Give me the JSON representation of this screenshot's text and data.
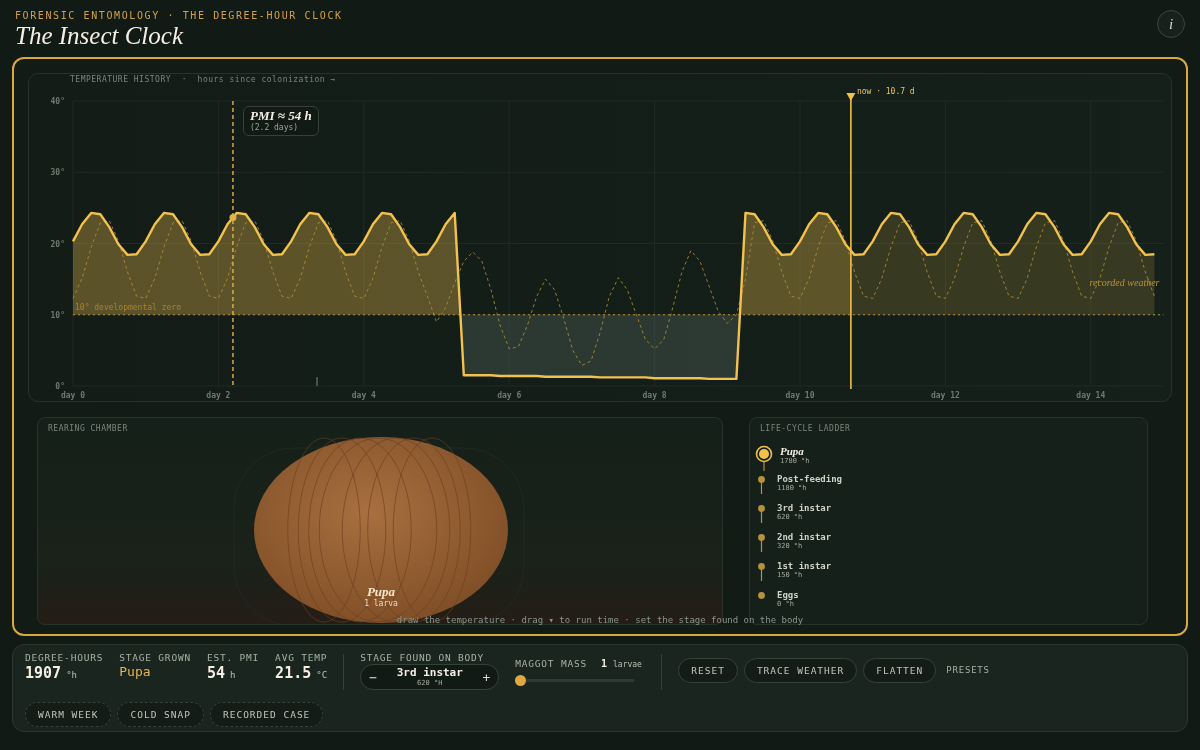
{
  "header": {
    "eyebrow": "FORENSIC ENTOMOLOGY · THE DEGREE-HOUR CLOCK",
    "title": "The Insect Clock",
    "info_button": "i"
  },
  "temperature_history": {
    "title": "TEMPERATURE HISTORY  ·  hours since colonization →",
    "pmi_marker": {
      "label": "PMI ≈ 54 h",
      "sublabel": "(2.2 days)"
    },
    "now_marker": {
      "label": "now · 10.7 d"
    },
    "chart_data": {
      "type": "line",
      "grid": true,
      "ylim": [
        0,
        40
      ],
      "categories": [
        "day 0",
        null,
        null,
        null,
        null,
        null,
        null,
        null,
        null,
        null,
        null,
        null,
        null,
        null,
        null,
        null,
        "day 2",
        null,
        null,
        null,
        null,
        null,
        null,
        null,
        null,
        null,
        null,
        null,
        null,
        null,
        null,
        null,
        "day 4",
        null,
        null,
        null,
        null,
        null,
        null,
        null,
        null,
        null,
        null,
        null,
        null,
        null,
        null,
        null,
        "day 6",
        null,
        null,
        null,
        null,
        null,
        null,
        null,
        null,
        null,
        null,
        null,
        null,
        null,
        null,
        null,
        "day 8",
        null,
        null,
        null,
        null,
        null,
        null,
        null,
        null,
        null,
        null,
        null,
        null,
        null,
        null,
        null,
        "day 10",
        null,
        null,
        null,
        null,
        null,
        null,
        null,
        null,
        null,
        null,
        null,
        null,
        null,
        null,
        null,
        "day 12",
        null,
        null,
        null,
        null,
        null,
        null,
        null,
        null,
        null,
        null,
        null,
        null,
        null,
        null,
        null,
        "day 14",
        null,
        null,
        null,
        null,
        null,
        null,
        null
      ],
      "yticks": [
        {
          "value": 0,
          "label": "0°"
        },
        {
          "value": 10,
          "label": "10°"
        },
        {
          "value": 20,
          "label": "20°"
        },
        {
          "value": 30,
          "label": "30°"
        },
        {
          "value": 40,
          "label": "40°"
        }
      ],
      "series": [
        {
          "color": "#f2c14e",
          "values": [
            20.3,
            22.7,
            24.3,
            24.1,
            22.3,
            19.9,
            18.4,
            18.5,
            20.3,
            22.7,
            24.3,
            24.1,
            22.3,
            19.9,
            18.4,
            18.5,
            20.3,
            22.7,
            24.3,
            24.1,
            22.3,
            19.9,
            18.4,
            18.5,
            20.3,
            22.7,
            24.3,
            24.1,
            22.3,
            19.9,
            18.4,
            18.5,
            20.3,
            22.7,
            24.3,
            24.1,
            22.3,
            19.9,
            18.4,
            18.5,
            20.3,
            22.7,
            24.3,
            1.5,
            1.5,
            1.5,
            1.5,
            1.4,
            1.4,
            1.4,
            1.4,
            1.4,
            1.3,
            1.3,
            1.3,
            1.3,
            1.3,
            1.3,
            1.2,
            1.2,
            1.2,
            1.2,
            1.2,
            1.2,
            1.1,
            1.1,
            1.1,
            1.1,
            1.1,
            1.1,
            1.0,
            1.0,
            1.0,
            1.0,
            24.3,
            24.1,
            22.3,
            19.9,
            18.4,
            18.5,
            20.3,
            22.7,
            24.3,
            24.1,
            22.3,
            19.9,
            18.4,
            18.5,
            20.3,
            22.7,
            24.3,
            24.1,
            22.3,
            19.9,
            18.4,
            18.5,
            20.3,
            22.7,
            24.3,
            24.1,
            22.3,
            19.9,
            18.4,
            18.5,
            20.3,
            22.7,
            24.3,
            24.1,
            22.3,
            19.9,
            18.4,
            18.5,
            20.3,
            22.7,
            24.3,
            24.1,
            22.3,
            19.9,
            18.4,
            18.5
          ]
        },
        {
          "name": "recorded weather",
          "color": "#b8923a",
          "line_style": "dashed",
          "values": [
            12.3,
            15.1,
            19.5,
            22.9,
            23.2,
            20.4,
            16.0,
            12.6,
            12.3,
            15.1,
            19.5,
            22.9,
            23.2,
            20.4,
            16.0,
            12.6,
            12.3,
            15.1,
            19.5,
            22.9,
            23.2,
            20.4,
            16.0,
            12.6,
            12.3,
            15.1,
            19.5,
            22.9,
            23.2,
            20.4,
            16.0,
            12.6,
            12.3,
            15.1,
            19.5,
            22.9,
            23.2,
            20.4,
            16.0,
            12.6,
            9.0,
            11,
            14.5,
            17.5,
            18.8,
            17.5,
            13.5,
            8.5,
            5.2,
            5.5,
            8.5,
            12.5,
            15,
            13.5,
            9.5,
            5,
            2.9,
            3.5,
            7.5,
            12.5,
            15.2,
            13.5,
            10,
            6.5,
            5.2,
            6.5,
            11,
            16,
            19,
            17.5,
            14,
            10.5,
            8.8,
            10,
            15,
            22.9,
            23.2,
            20.4,
            16.0,
            12.6,
            12.3,
            15.1,
            19.5,
            22.9,
            23.2,
            20.4,
            16.0,
            12.6,
            12.3,
            15.1,
            19.5,
            22.9,
            23.2,
            20.4,
            16.0,
            12.6,
            12.3,
            15.1,
            19.5,
            22.9,
            23.2,
            20.4,
            16.0,
            12.6,
            12.3,
            15.1,
            19.5,
            22.9,
            23.2,
            20.4,
            16.0,
            12.6,
            12.3,
            15.1,
            19.5,
            22.9,
            23.2,
            20.4,
            16.0,
            12.6
          ]
        }
      ],
      "ref_lines": [
        {
          "axis": "y",
          "value": 10,
          "label": "10° developmental zero"
        }
      ]
    }
  },
  "rearing_chamber": {
    "title": "REARING CHAMBER",
    "specimen": {
      "kind": "pupa",
      "label": "Pupa",
      "count": "1 larva"
    }
  },
  "life_cycle_ladder": {
    "title": "LIFE-CYCLE LADDER",
    "stages": [
      {
        "name": "Pupa",
        "threshold": "1780 °h",
        "selected": true
      },
      {
        "name": "Post-feeding",
        "threshold": "1180 °h",
        "selected": false
      },
      {
        "name": "3rd instar",
        "threshold": "620 °h",
        "selected": false
      },
      {
        "name": "2nd instar",
        "threshold": "320 °h",
        "selected": false
      },
      {
        "name": "1st instar",
        "threshold": "150 °h",
        "selected": false
      },
      {
        "name": "Eggs",
        "threshold": "0 °h",
        "selected": false
      }
    ]
  },
  "hint": "draw the temperature · drag ▾ to run time · set the stage found on the body",
  "controls": {
    "stats": [
      {
        "label": "DEGREE-HOURS",
        "value": "1907",
        "unit": "°h",
        "accent": false
      },
      {
        "label": "STAGE GROWN",
        "value": "Pupa",
        "accent": true
      },
      {
        "label": "EST. PMI",
        "value": "54",
        "unit": "h",
        "accent": false
      },
      {
        "label": "AVG TEMP",
        "value": "21.5",
        "unit": "°C",
        "accent": false
      }
    ],
    "stage_found": {
      "label": "STAGE FOUND ON BODY",
      "minus": "−",
      "value": "3rd instar",
      "threshold": "620 °H",
      "plus": "+"
    },
    "maggot_mass": {
      "label": "MAGGOT MASS",
      "count": "1",
      "unit": "larvae",
      "level": 0
    },
    "buttons": [
      "RESET",
      "TRACE WEATHER",
      "FLATTEN"
    ],
    "presets": {
      "label": "PRESETS",
      "items": [
        "WARM WEEK",
        "COLD SNAP",
        "RECORDED CASE"
      ]
    }
  }
}
